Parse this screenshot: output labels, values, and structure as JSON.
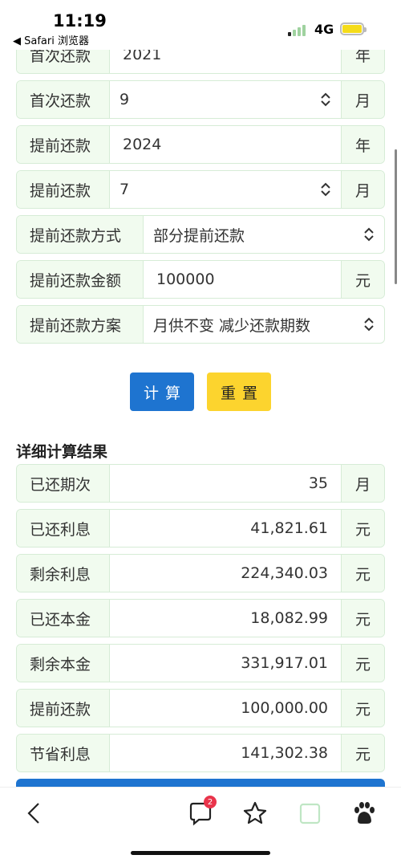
{
  "status": {
    "time": "11:19",
    "back_app": "◀ Safari 浏览器",
    "network": "4G"
  },
  "form": {
    "first_year": {
      "label": "首次还款",
      "value": "2021",
      "unit": "年"
    },
    "first_month": {
      "label": "首次还款",
      "value": "9",
      "unit": "月"
    },
    "prepay_year": {
      "label": "提前还款",
      "value": "2024",
      "unit": "年"
    },
    "prepay_month": {
      "label": "提前还款",
      "value": "7",
      "unit": "月"
    },
    "prepay_method": {
      "label": "提前还款方式",
      "value": "部分提前还款"
    },
    "prepay_amount": {
      "label": "提前还款金额",
      "value": "100000",
      "unit": "元"
    },
    "prepay_plan": {
      "label": "提前还款方案",
      "value": "月供不变 减少还款期数"
    }
  },
  "buttons": {
    "calc": "计算",
    "reset": "重置"
  },
  "results": {
    "title": "详细计算结果",
    "rows": [
      {
        "label": "已还期次",
        "value": "35",
        "unit": "月"
      },
      {
        "label": "已还利息",
        "value": "41,821.61",
        "unit": "元"
      },
      {
        "label": "剩余利息",
        "value": "224,340.03",
        "unit": "元"
      },
      {
        "label": "已还本金",
        "value": "18,082.99",
        "unit": "元"
      },
      {
        "label": "剩余本金",
        "value": "331,917.01",
        "unit": "元"
      },
      {
        "label": "提前还款",
        "value": "100,000.00",
        "unit": "元"
      },
      {
        "label": "节省利息",
        "value": "141,302.38",
        "unit": "元"
      }
    ]
  },
  "toolbar": {
    "comments_badge": "2",
    "icons": [
      "back-icon",
      "comment-icon",
      "star-icon",
      "tabs-icon",
      "baidu-paw-icon"
    ]
  },
  "colors": {
    "primary": "#1e74d0",
    "warning": "#fcd42e",
    "label_bg": "#f1fbef",
    "border": "#d6ecd6"
  }
}
